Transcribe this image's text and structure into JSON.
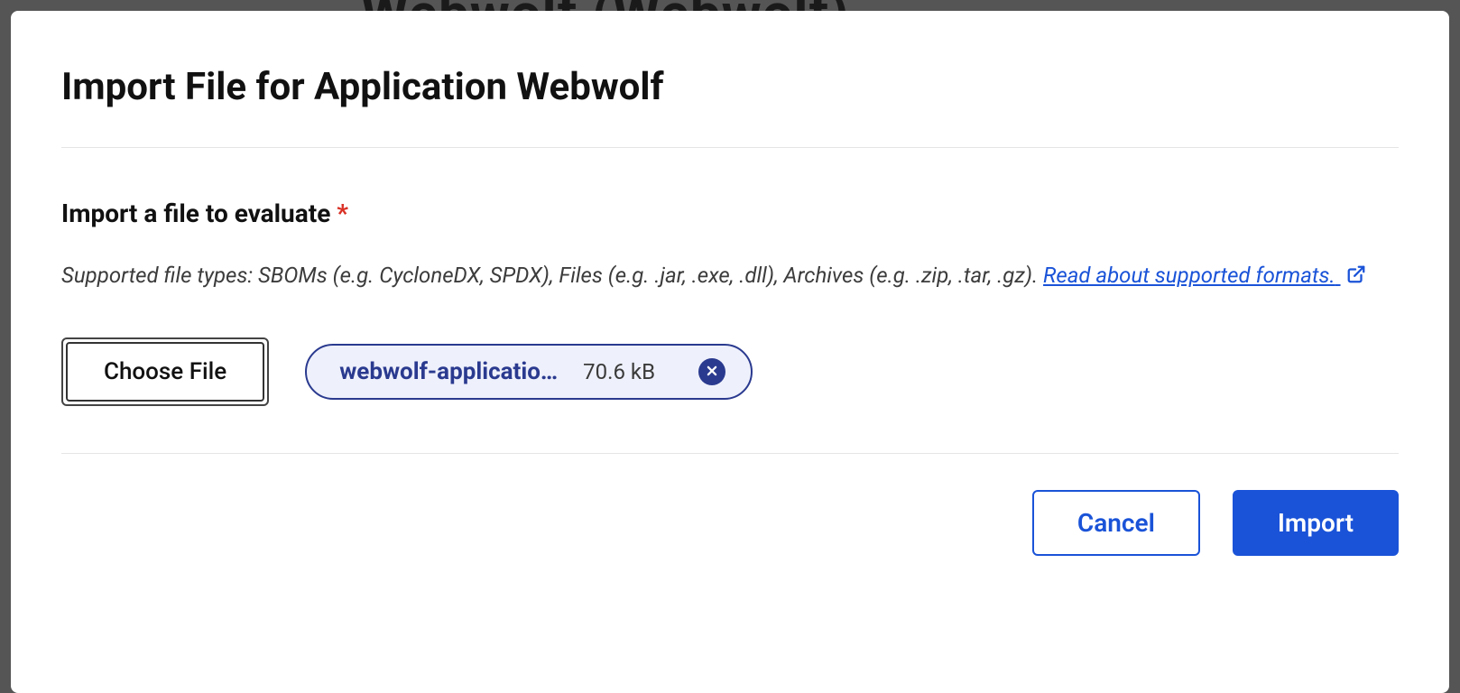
{
  "backdrop": {
    "faded_title": "Webwolf (Webwolf)"
  },
  "modal": {
    "title": "Import File for Application Webwolf",
    "section_label": "Import a file to evaluate",
    "required_marker": "*",
    "help_text_prefix": "Supported file types: SBOMs (e.g. CycloneDX, SPDX), Files (e.g. .jar, .exe, .dll), Archives (e.g. .zip, .tar, .gz). ",
    "help_link_text": "Read about supported formats.",
    "choose_file_label": "Choose File",
    "selected_file": {
      "display_name": "webwolf-applicatio…",
      "size": "70.6 kB"
    },
    "footer": {
      "cancel_label": "Cancel",
      "import_label": "Import"
    }
  }
}
